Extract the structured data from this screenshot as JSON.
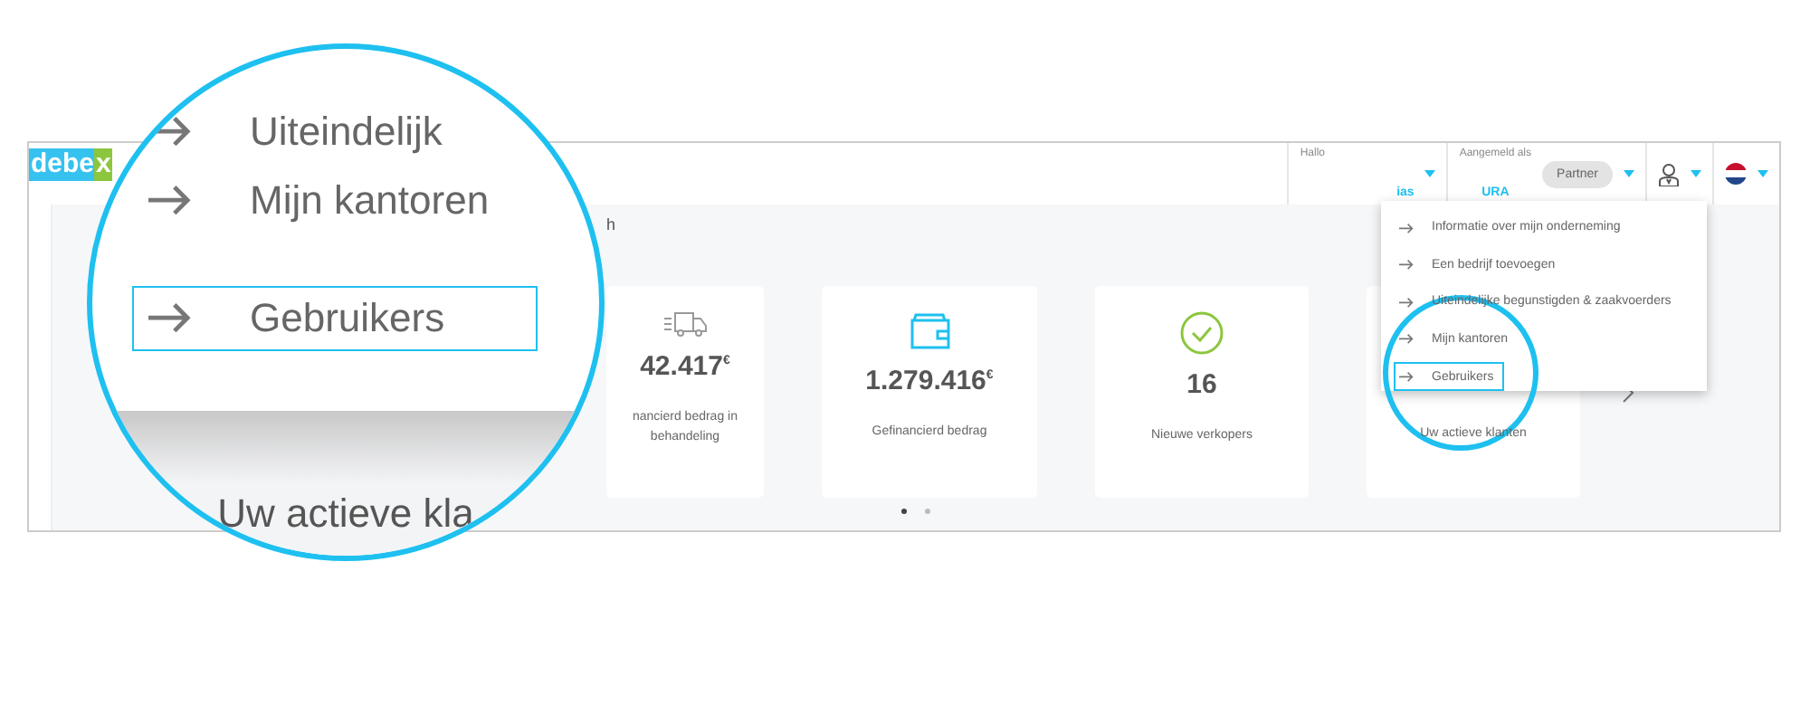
{
  "logo": {
    "main": "debe",
    "accent": "x"
  },
  "header": {
    "greeting_label": "Hallo",
    "greeting_name": "ias",
    "signed_in_label": "Aangemeld als",
    "signed_in_name": "URA",
    "role_badge": "Partner"
  },
  "section_title": "h",
  "cards": [
    {
      "kind": "truck",
      "value": "42.417$^{€}$",
      "label": "nancierd bedrag in behandeling"
    },
    {
      "kind": "wallet",
      "value": "1.279.416$^{€}$",
      "label": "Gefinancierd bedrag"
    },
    {
      "kind": "check",
      "value": "16",
      "label": "Nieuwe verkopers"
    },
    {
      "kind": "hidden",
      "label": "Uw actieve klanten"
    }
  ],
  "carousel_dots": [
    {
      "selected": true
    },
    {
      "selected": false
    }
  ],
  "account_menu": {
    "items": [
      {
        "label": "Informatie over mijn onderneming",
        "selected": false
      },
      {
        "label": "Een bedrijf toevoegen",
        "selected": false
      },
      {
        "label": "Uiteindelijke begunstigden & zaakvoerders",
        "selected": false
      },
      {
        "label": "Mijn kantoren",
        "selected": false
      },
      {
        "label": "Gebruikers",
        "selected": true
      }
    ]
  },
  "magnifier": {
    "items": [
      {
        "label": "Uiteindelijk",
        "selected": false
      },
      {
        "label": "Mijn kantoren",
        "selected": false
      },
      {
        "label": "Gebruikers",
        "selected": true
      }
    ],
    "caption": "Uw actieve kla"
  }
}
